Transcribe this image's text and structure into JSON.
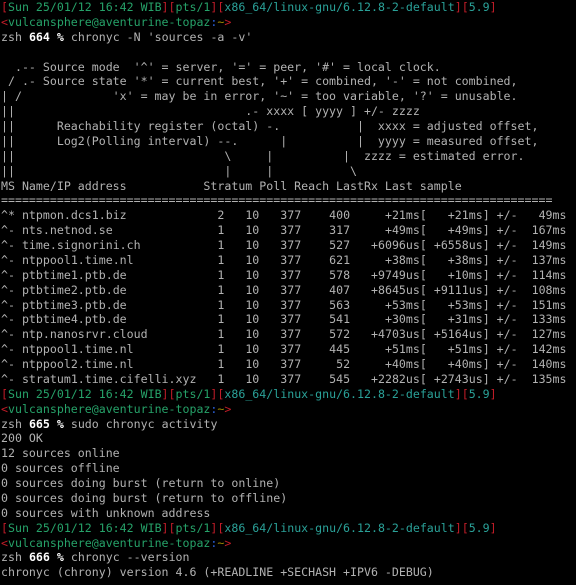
{
  "terminal": {
    "window_title": "chronyc terminal session",
    "colors": {
      "background": "#000000",
      "foreground": "#b2b2b2",
      "red": "#c01c28",
      "green": "#26a269",
      "teal": "#2aa198",
      "blue": "#2a5fd6",
      "olive": "#a08a00",
      "white": "#ffffff"
    },
    "prompt": {
      "bracket_open": "[",
      "bracket_close": "]",
      "datetime": "Sun 25/01/12 16:42 WIB",
      "tty": "pts/1",
      "arch": "x86_64/linux-gnu/6.12.8-2-default",
      "shell_version": "5.9",
      "user_host": "vulcansphere@aventurine-topaz",
      "lt": "<",
      "gt": ">",
      "colon": ":",
      "cwd": "~",
      "shell_name": "zsh",
      "percent": "%"
    },
    "blocks": [
      {
        "cmd_number": "664",
        "command": "chronyc -N 'sources -a -v'"
      },
      {
        "cmd_number": "665",
        "command": "sudo chronyc activity"
      },
      {
        "cmd_number": "666",
        "command": "chronyc --version"
      }
    ],
    "legend": [
      "  .-- Source mode  '^' = server, '=' = peer, '#' = local clock.",
      " / .- Source state '*' = current best, '+' = combined, '-' = not combined,",
      "| /             'x' = may be in error, '~' = too variable, '?' = unusable.",
      "||                                 .- xxxx [ yyyy ] +/- zzzz",
      "||      Reachability register (octal) -.           |  xxxx = adjusted offset,",
      "||      Log2(Polling interval) --.      |          |  yyyy = measured offset,",
      "||                              \\     |          |  zzzz = estimated error.",
      "||                              |     |           \\"
    ],
    "table": {
      "header": "MS Name/IP address           Stratum Poll Reach LastRx Last sample",
      "separator": "===============================================================================",
      "columns": [
        "MS",
        "Name/IP address",
        "Stratum",
        "Poll",
        "Reach",
        "LastRx",
        "Last sample"
      ],
      "rows": [
        {
          "ms": "^*",
          "name": "ntpmon.dcs1.biz",
          "stratum": "2",
          "poll": "10",
          "reach": "377",
          "lastrx": "400",
          "adjusted": "+21ms",
          "measured": "+21ms",
          "pm": "+/-",
          "error": "49ms"
        },
        {
          "ms": "^-",
          "name": "nts.netnod.se",
          "stratum": "1",
          "poll": "10",
          "reach": "377",
          "lastrx": "317",
          "adjusted": "+49ms",
          "measured": "+49ms",
          "pm": "+/-",
          "error": "167ms"
        },
        {
          "ms": "^-",
          "name": "time.signorini.ch",
          "stratum": "1",
          "poll": "10",
          "reach": "377",
          "lastrx": "527",
          "adjusted": "+6096us",
          "measured": "+6558us",
          "pm": "+/-",
          "error": "149ms"
        },
        {
          "ms": "^-",
          "name": "ntppool1.time.nl",
          "stratum": "1",
          "poll": "10",
          "reach": "377",
          "lastrx": "621",
          "adjusted": "+38ms",
          "measured": "+38ms",
          "pm": "+/-",
          "error": "137ms"
        },
        {
          "ms": "^-",
          "name": "ptbtime1.ptb.de",
          "stratum": "1",
          "poll": "10",
          "reach": "377",
          "lastrx": "578",
          "adjusted": "+9749us",
          "measured": "+10ms",
          "pm": "+/-",
          "error": "114ms"
        },
        {
          "ms": "^-",
          "name": "ptbtime2.ptb.de",
          "stratum": "1",
          "poll": "10",
          "reach": "377",
          "lastrx": "407",
          "adjusted": "+8645us",
          "measured": "+9111us",
          "pm": "+/-",
          "error": "108ms"
        },
        {
          "ms": "^-",
          "name": "ptbtime3.ptb.de",
          "stratum": "1",
          "poll": "10",
          "reach": "377",
          "lastrx": "563",
          "adjusted": "+53ms",
          "measured": "+53ms",
          "pm": "+/-",
          "error": "151ms"
        },
        {
          "ms": "^-",
          "name": "ptbtime4.ptb.de",
          "stratum": "1",
          "poll": "10",
          "reach": "377",
          "lastrx": "541",
          "adjusted": "+30ms",
          "measured": "+31ms",
          "pm": "+/-",
          "error": "133ms"
        },
        {
          "ms": "^-",
          "name": "ntp.nanosrvr.cloud",
          "stratum": "1",
          "poll": "10",
          "reach": "377",
          "lastrx": "572",
          "adjusted": "+4703us",
          "measured": "+5164us",
          "pm": "+/-",
          "error": "127ms"
        },
        {
          "ms": "^-",
          "name": "ntppool1.time.nl",
          "stratum": "1",
          "poll": "10",
          "reach": "377",
          "lastrx": "445",
          "adjusted": "+51ms",
          "measured": "+51ms",
          "pm": "+/-",
          "error": "142ms"
        },
        {
          "ms": "^-",
          "name": "ntppool2.time.nl",
          "stratum": "1",
          "poll": "10",
          "reach": "377",
          "lastrx": "52",
          "adjusted": "+40ms",
          "measured": "+40ms",
          "pm": "+/-",
          "error": "140ms"
        },
        {
          "ms": "^-",
          "name": "stratum1.time.cifelli.xyz",
          "stratum": "1",
          "poll": "10",
          "reach": "377",
          "lastrx": "545",
          "adjusted": "+2282us",
          "measured": "+2743us",
          "pm": "+/-",
          "error": "135ms"
        }
      ]
    },
    "activity_output": [
      "200 OK",
      "12 sources online",
      "0 sources offline",
      "0 sources doing burst (return to online)",
      "0 sources doing burst (return to offline)",
      "0 sources with unknown address"
    ],
    "version_output": "chronyc (chrony) version 4.6 (+READLINE +SECHASH +IPV6 -DEBUG)"
  }
}
